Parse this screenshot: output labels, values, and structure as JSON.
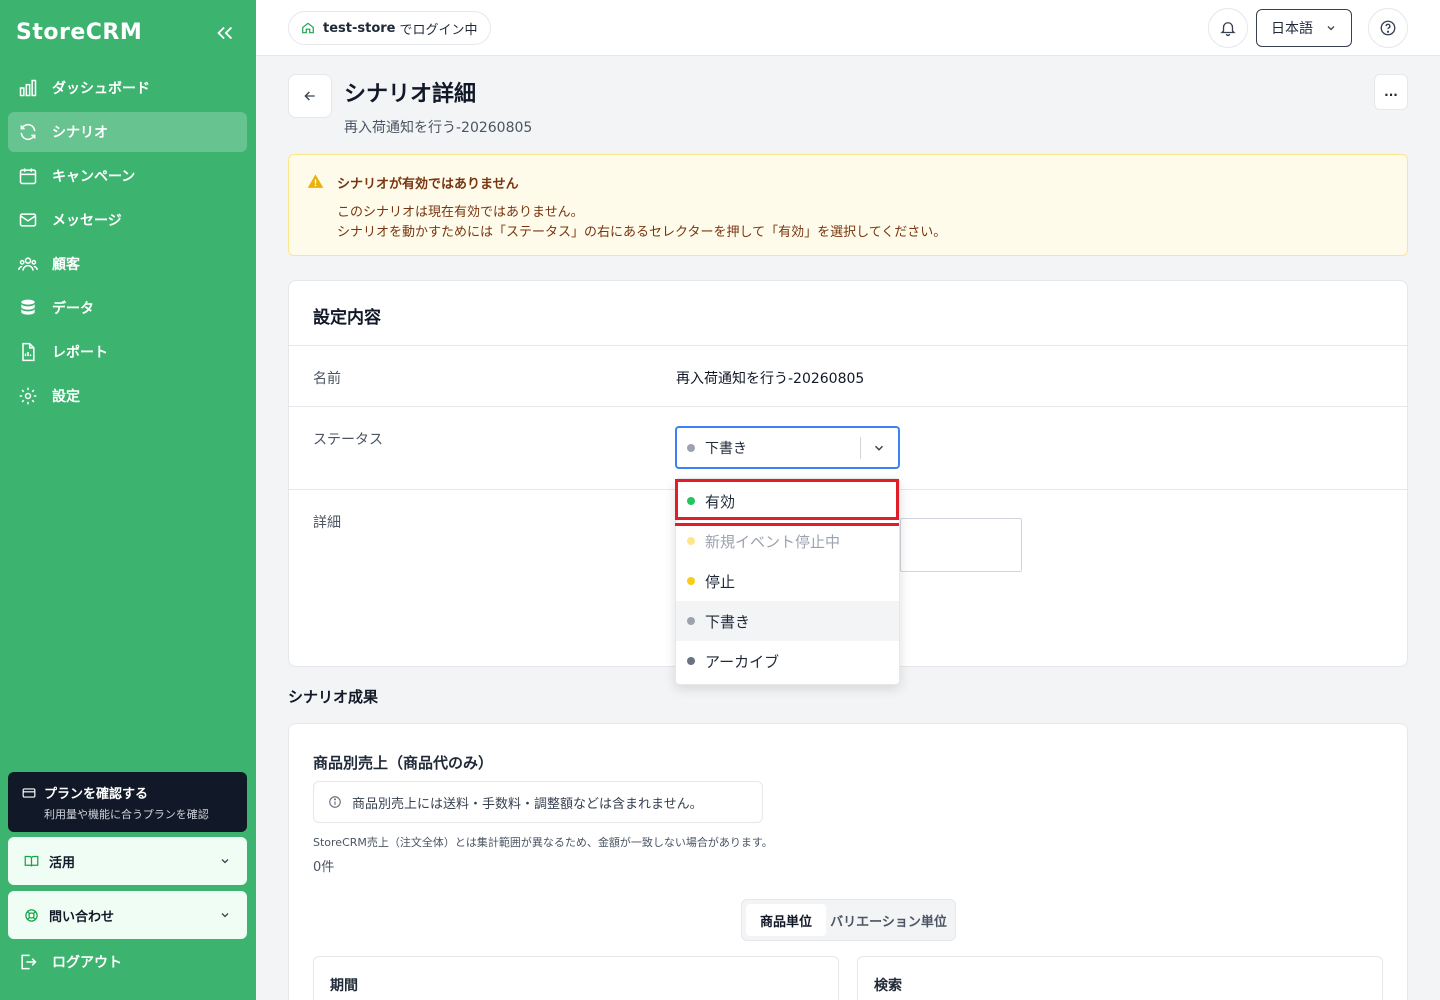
{
  "sidebar": {
    "brand": "StoreCRM",
    "items": [
      {
        "label": "ダッシュボード",
        "icon": "chart-bar-icon",
        "active": false
      },
      {
        "label": "シナリオ",
        "icon": "refresh-icon",
        "active": true
      },
      {
        "label": "キャンペーン",
        "icon": "calendar-icon",
        "active": false
      },
      {
        "label": "メッセージ",
        "icon": "mail-icon",
        "active": false
      },
      {
        "label": "顧客",
        "icon": "users-icon",
        "active": false
      },
      {
        "label": "データ",
        "icon": "database-icon",
        "active": false
      },
      {
        "label": "レポート",
        "icon": "document-chart-icon",
        "active": false
      },
      {
        "label": "設定",
        "icon": "gear-icon",
        "active": false
      }
    ],
    "plan": {
      "title": "プランを確認する",
      "subtitle": "利用量や機能に合うプランを確認"
    },
    "usage": {
      "label": "活用"
    },
    "contact": {
      "label": "問い合わせ"
    },
    "logout": {
      "label": "ログアウト"
    }
  },
  "header": {
    "store_name": "test-store",
    "store_suffix": "でログイン中",
    "language": "日本語"
  },
  "page": {
    "title": "シナリオ詳細",
    "subtitle": "再入荷通知を行う-20260805",
    "more": "..."
  },
  "alert": {
    "title": "シナリオが有効ではありません",
    "line1": "このシナリオは現在有効ではありません。",
    "line2": "シナリオを動かすためには「ステータス」の右にあるセレクターを押して「有効」を選択してください。"
  },
  "settings": {
    "title": "設定内容",
    "name_label": "名前",
    "name_value": "再入荷通知を行う-20260805",
    "status_label": "ステータス",
    "status_value": "下書き",
    "detail_label": "詳細"
  },
  "status_options": [
    {
      "label": "有効",
      "color": "#22c55e",
      "disabled": false,
      "highlighted": true
    },
    {
      "label": "新規イベント停止中",
      "color": "#facc15",
      "disabled": true,
      "highlighted": false
    },
    {
      "label": "停止",
      "color": "#facc15",
      "disabled": false,
      "highlighted": false
    },
    {
      "label": "下書き",
      "color": "#9ca3af",
      "disabled": false,
      "highlighted": false
    },
    {
      "label": "アーカイブ",
      "color": "#6b7280",
      "disabled": false,
      "highlighted": false
    }
  ],
  "results": {
    "section_title": "シナリオ成果",
    "card_title": "商品別売上（商品代のみ）",
    "info": "商品別売上には送料・手数料・調整額などは含まれません。",
    "note": "StoreCRM売上（注文全体）とは集計範囲が異なるため、金額が一致しない場合があります。",
    "count": "0件",
    "tabs": [
      "商品単位",
      "バリエーション単位"
    ],
    "period_label": "期間",
    "search_label": "検索"
  },
  "colors": {
    "sidebar_bg": "#3db370",
    "accent_green": "#22c55e",
    "highlight_red": "#e11d2a",
    "select_border": "#3b82f6"
  }
}
